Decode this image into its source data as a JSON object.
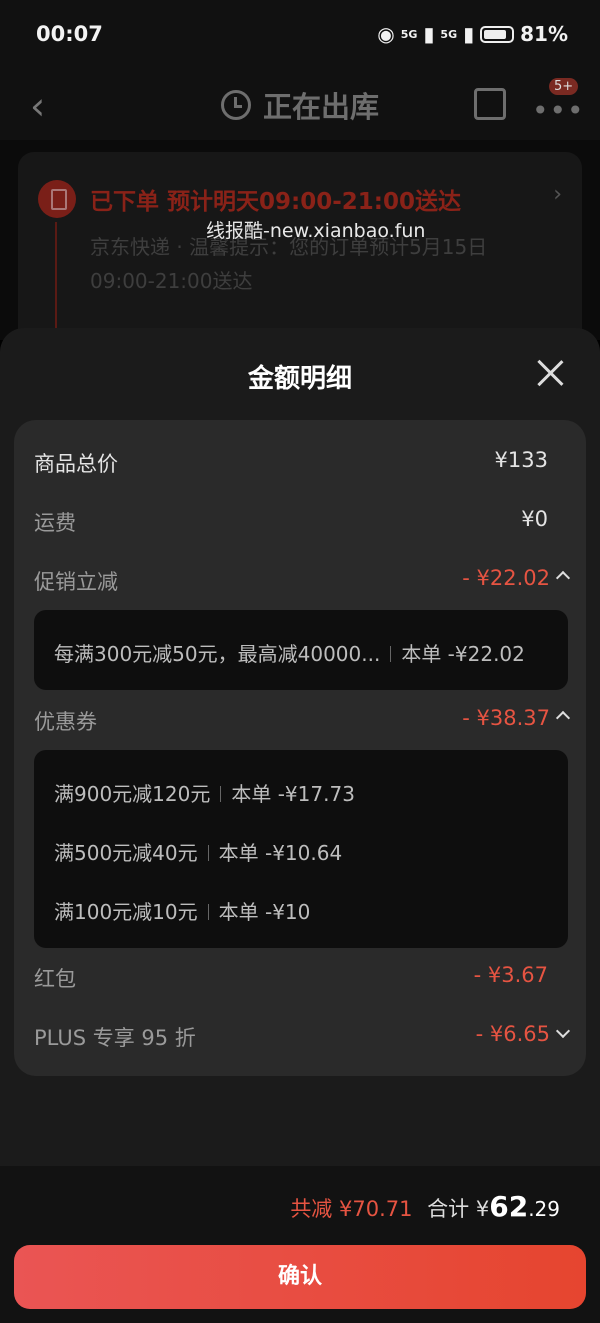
{
  "status_bar": {
    "time": "00:07",
    "signal_1": "5G",
    "signal_2": "5G",
    "battery": "81%"
  },
  "nav": {
    "title": "正在出库",
    "badge": "5+"
  },
  "order": {
    "status": "已下单 预计明天09:00-21:00送达",
    "description": "京东快递 · 温馨提示：您的订单预计5月15日09:00-21:00送达"
  },
  "watermark": "线报酷-new.xianbao.fun",
  "sheet": {
    "title": "金额明细",
    "rows": {
      "total": {
        "label": "商品总价",
        "value": "¥133"
      },
      "shipping": {
        "label": "运费",
        "value": "¥0"
      },
      "promo": {
        "label": "促销立减",
        "value": "- ¥22.02"
      },
      "coupon": {
        "label": "优惠券",
        "value": "- ¥38.37"
      },
      "redpacket": {
        "label": "红包",
        "value": "- ¥3.67"
      },
      "plus": {
        "label": "PLUS 专享 95 折",
        "value": "- ¥6.65"
      }
    },
    "promo_details": [
      {
        "rule": "每满300元减50元，最高减40000...",
        "amount": "本单 -¥22.02"
      }
    ],
    "coupon_details": [
      {
        "rule": "满900元减120元",
        "amount": "本单 -¥17.73"
      },
      {
        "rule": "满500元减40元",
        "amount": "本单 -¥10.64"
      },
      {
        "rule": "满100元减10元",
        "amount": "本单 -¥10"
      }
    ]
  },
  "footer": {
    "saved": "共减 ¥70.71",
    "total_label": "合计",
    "total_currency": "¥",
    "total_int": "62",
    "total_dec": ".29",
    "confirm_label": "确认"
  },
  "colors": {
    "accent": "#e65442",
    "button_start": "#ea5554",
    "button_end": "#e6452f"
  }
}
